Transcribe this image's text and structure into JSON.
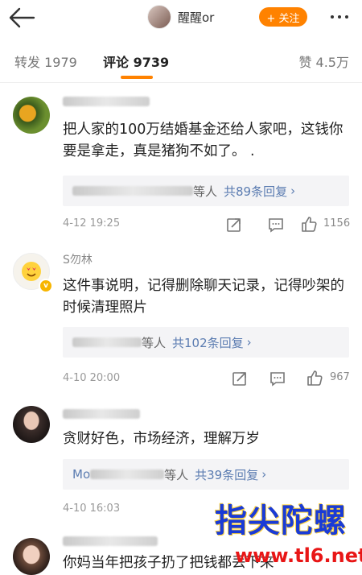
{
  "header": {
    "profile_name": "醒醒or",
    "follow_label": "+ 关注"
  },
  "tabs": {
    "repost": "转发 1979",
    "comment": "评论 9739",
    "like": "赞 4.5万"
  },
  "comments": [
    {
      "text": "把人家的100万结婚基金还给人家吧，这钱你要是拿走，真是猪狗不如了。 .",
      "reply_suffix": "等人",
      "reply_link": "共89条回复",
      "time": "4-12 19:25",
      "likes": "1156"
    },
    {
      "username_visible": "S勿林",
      "text": "这件事说明，记得删除聊天记录，记得吵架的时候清理照片",
      "reply_suffix": "等人",
      "reply_link": "共102条回复",
      "time": "4-10 20:00",
      "likes": "967"
    },
    {
      "text": "贪财好色，市场经济，理解万岁",
      "reply_prefix_visible": "Mo",
      "reply_suffix": "等人",
      "reply_link": "共39条回复",
      "time": "4-10 16:03"
    },
    {
      "text": "你妈当年把孩子扔了把钱都丢下来"
    }
  ],
  "watermark": {
    "line1": "指尖陀螺",
    "line2": "www.tl6.net"
  },
  "colors": {
    "accent": "#ff8200",
    "link": "#5b7cb1",
    "verified_badge": "#f7b500"
  }
}
